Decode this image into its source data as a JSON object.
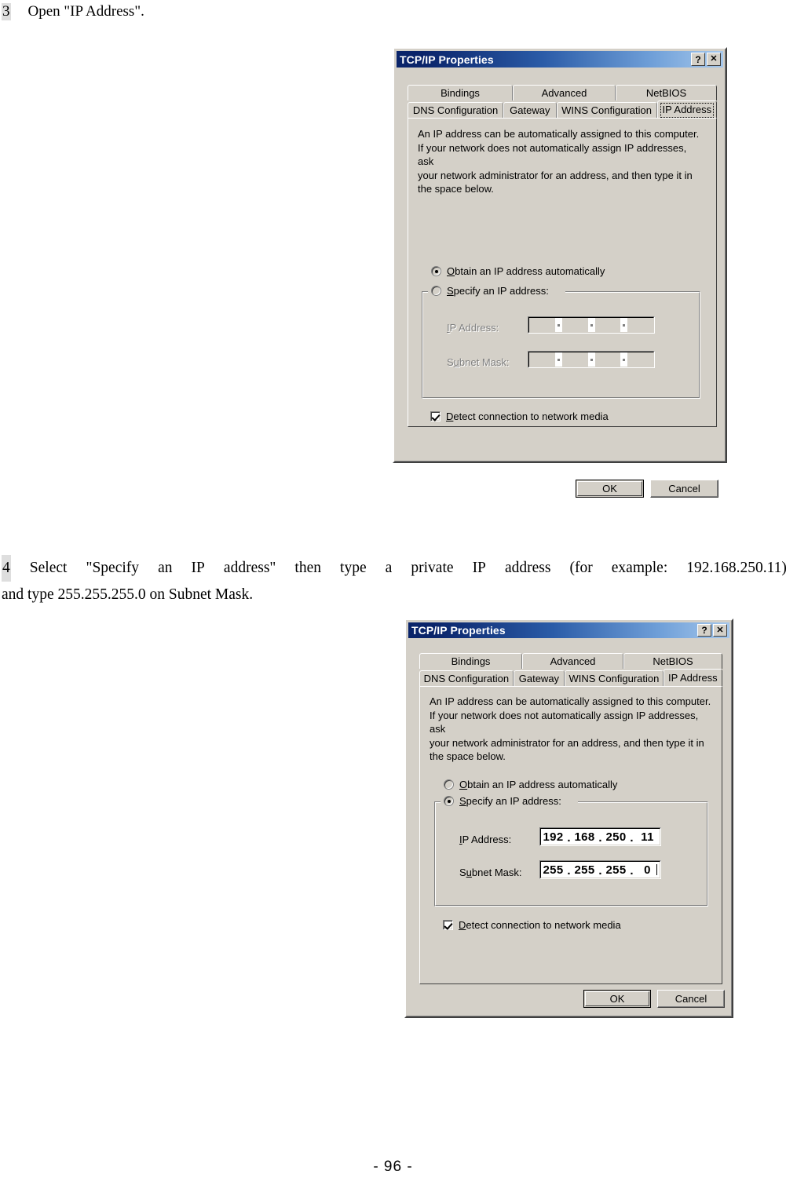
{
  "page": {
    "footer": "- 96 -"
  },
  "steps": {
    "step3": {
      "number": "3",
      "text": "Open \"IP Address\"."
    },
    "step4": {
      "number": "4",
      "line1_words": [
        "Select",
        "\"Specify",
        "an",
        "IP",
        "address\"",
        "then",
        "type",
        "a",
        "private",
        "IP",
        "address",
        "",
        "(for",
        "example:",
        "192.168.250.11)"
      ],
      "line2": "and type 255.255.255.0 on Subnet Mask."
    }
  },
  "dialog1": {
    "title": "TCP/IP Properties",
    "help_button": "?",
    "close_button": "✕",
    "tabs_row1": [
      "Bindings",
      "Advanced",
      "NetBIOS"
    ],
    "tabs_row2": [
      "DNS Configuration",
      "Gateway",
      "WINS Configuration",
      "IP Address"
    ],
    "selected_tab": "IP Address",
    "description": "An IP address can be automatically assigned to this computer.\nIf your network does not automatically assign IP addresses, ask\nyour network administrator for an address, and then type it in\nthe space below.",
    "radio_obtain": "Obtain an IP address automatically",
    "radio_obtain_underline": "O",
    "radio_obtain_rest": "btain an IP address automatically",
    "radio_specify_underline": "S",
    "radio_specify_rest": "pecify an IP address:",
    "label_ip": "IP Address:",
    "label_ip_underline": "I",
    "label_ip_rest": "P Address:",
    "label_subnet_underline": "S",
    "label_subnet_pre": "u",
    "label_subnet_rest": "bnet Mask:",
    "selected_radio": "obtain",
    "ip_value": [
      "",
      "",
      "",
      ""
    ],
    "subnet_value": [
      "",
      "",
      "",
      ""
    ],
    "checkbox_label_underline": "D",
    "checkbox_label_rest": "etect connection to network media",
    "checkbox_checked": true,
    "ok_button": "OK",
    "cancel_button": "Cancel"
  },
  "dialog2": {
    "title": "TCP/IP Properties",
    "help_button": "?",
    "close_button": "✕",
    "tabs_row1": [
      "Bindings",
      "Advanced",
      "NetBIOS"
    ],
    "tabs_row2": [
      "DNS Configuration",
      "Gateway",
      "WINS Configuration",
      "IP Address"
    ],
    "selected_tab": "IP Address",
    "description": "An IP address can be automatically assigned to this computer.\nIf your network does not automatically assign IP addresses, ask\nyour network administrator for an address, and then type it in\nthe space below.",
    "radio_obtain_underline": "O",
    "radio_obtain_rest": "btain an IP address automatically",
    "radio_specify_underline": "S",
    "radio_specify_rest": "pecify an IP address:",
    "label_ip_underline": "I",
    "label_ip_rest": "P Address:",
    "label_subnet_underline": "S",
    "label_subnet_pre": "u",
    "label_subnet_rest": "bnet Mask:",
    "selected_radio": "specify",
    "ip_value": [
      "192",
      "168",
      "250",
      "11"
    ],
    "subnet_value": [
      "255",
      "255",
      "255",
      "0"
    ],
    "checkbox_label_underline": "D",
    "checkbox_label_rest": "etect connection to network media",
    "checkbox_checked": true,
    "ok_button": "OK",
    "cancel_button": "Cancel"
  },
  "colors": {
    "dialog_face": "#d4d0c8",
    "title_gradient_start": "#0a246a",
    "title_gradient_end": "#a6c8ec",
    "disabled_text": "#808080"
  }
}
